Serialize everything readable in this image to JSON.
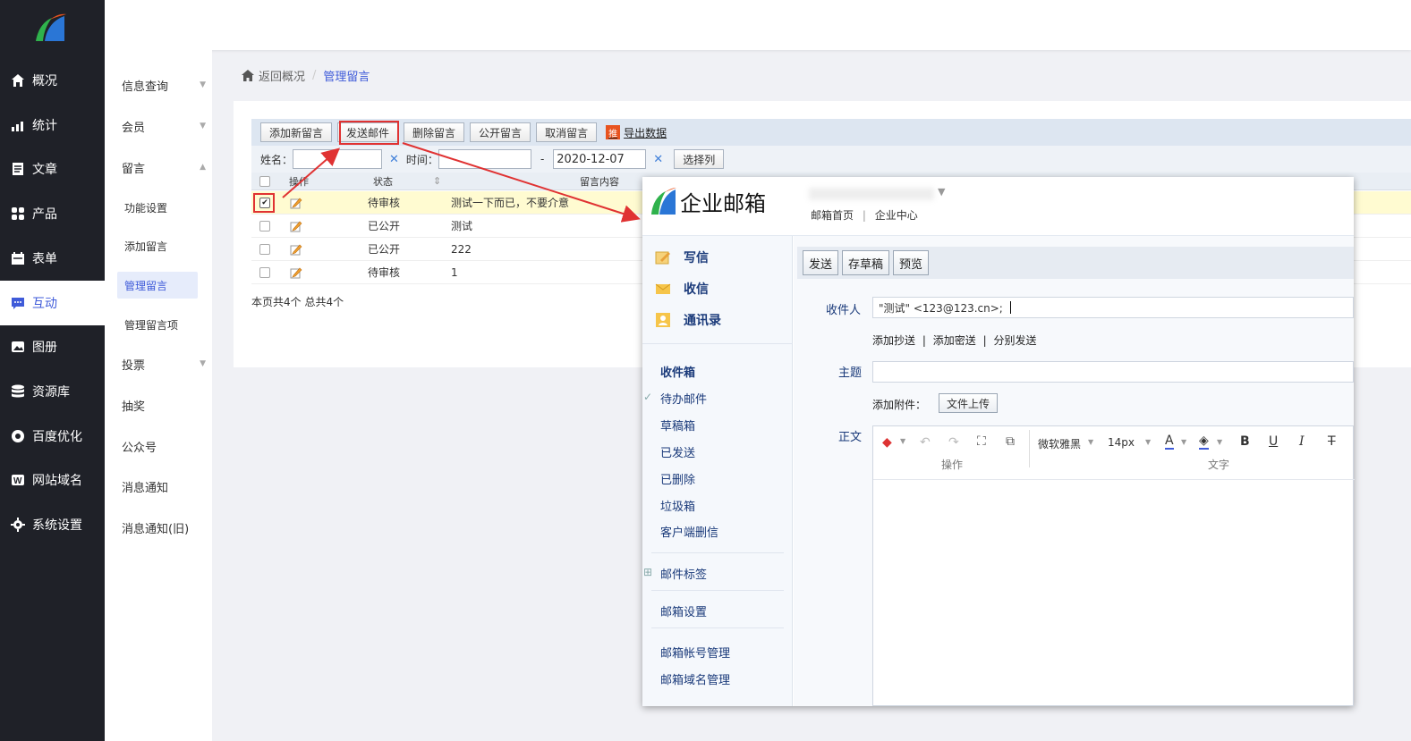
{
  "left_nav": {
    "items": [
      {
        "label": "概况",
        "icon": "home-icon"
      },
      {
        "label": "统计",
        "icon": "chart-icon"
      },
      {
        "label": "文章",
        "icon": "article-icon"
      },
      {
        "label": "产品",
        "icon": "grid-icon"
      },
      {
        "label": "表单",
        "icon": "calendar-icon"
      },
      {
        "label": "互动",
        "icon": "chat-icon"
      },
      {
        "label": "图册",
        "icon": "album-icon"
      },
      {
        "label": "资源库",
        "icon": "database-icon"
      },
      {
        "label": "百度优化",
        "icon": "seo-icon"
      },
      {
        "label": "网站域名",
        "icon": "domain-icon"
      },
      {
        "label": "系统设置",
        "icon": "gear-icon"
      }
    ]
  },
  "sub_nav": {
    "groups": [
      "信息查询",
      "会员",
      "留言",
      "投票",
      "抽奖",
      "公众号",
      "消息通知",
      "消息通知(旧)"
    ],
    "children": [
      "功能设置",
      "添加留言",
      "管理留言",
      "管理留言项"
    ]
  },
  "breadcrumb": {
    "back": "返回概况",
    "sep": "/",
    "current": "管理留言"
  },
  "toolbar": {
    "buttons": [
      "添加新留言",
      "发送邮件",
      "删除留言",
      "公开留言",
      "取消留言"
    ],
    "export_tag": "推",
    "export_label": "导出数据"
  },
  "filter": {
    "name_label": "姓名：",
    "name_value": "",
    "time_label": "时间：",
    "time_from": "",
    "dash": "-",
    "time_to": "2020-12-07",
    "clear": "✕",
    "select_columns": "选择列"
  },
  "grid": {
    "columns": [
      "操作",
      "状态",
      "留言内容"
    ],
    "rows": [
      {
        "status": "待审核",
        "content": "测试一下而已，不要介意",
        "checked": true
      },
      {
        "status": "已公开",
        "content": "测试",
        "checked": false
      },
      {
        "status": "已公开",
        "content": "222",
        "checked": false
      },
      {
        "status": "待审核",
        "content": "1",
        "checked": false
      }
    ],
    "page_info": "本页共4个 总共4个"
  },
  "mail": {
    "brand": "企业邮箱",
    "links": [
      "邮箱首页",
      "|",
      "企业中心"
    ],
    "side_primary": [
      "写信",
      "收信",
      "通讯录"
    ],
    "folders": [
      "收件箱",
      "待办邮件",
      "草稿箱",
      "已发送",
      "已删除",
      "垃圾箱",
      "客户端删信"
    ],
    "tags": "邮件标签",
    "settings": "邮箱设置",
    "accounts": [
      "邮箱帐号管理",
      "邮箱域名管理"
    ],
    "actions": [
      "发送",
      "存草稿",
      "预览"
    ],
    "to_label": "收件人",
    "to_value": "\"测试\" <123@123.cn>;",
    "cc_links": [
      "添加抄送",
      "|",
      "添加密送",
      "|",
      "分别发送"
    ],
    "subject_label": "主题",
    "subject_value": "",
    "attach_label": "添加附件：",
    "upload": "文件上传",
    "body_label": "正文",
    "editor": {
      "font": "微软雅黑",
      "size": "14px",
      "group_ops": "操作",
      "group_text": "文字",
      "bold": "B",
      "underline": "U",
      "italic": "I",
      "strike": "T"
    }
  },
  "colors": {
    "accent": "#3f5bd9",
    "nav_bg": "#1f2128",
    "highlight": "#e03232",
    "row_selected": "#fffbd1"
  }
}
